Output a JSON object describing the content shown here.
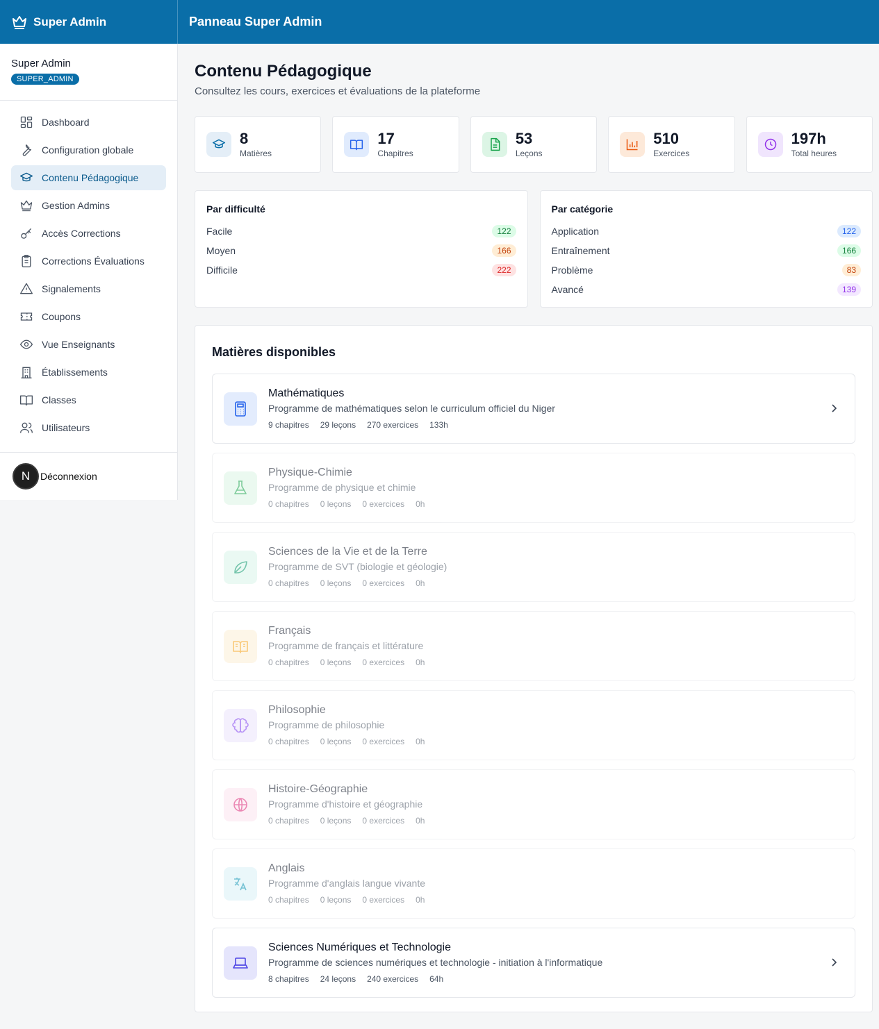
{
  "brand": {
    "title": "Super Admin",
    "icon": "crown-icon"
  },
  "topbar": {
    "title": "Panneau Super Admin"
  },
  "user": {
    "name": "Super Admin",
    "role": "SUPER_ADMIN",
    "avatar_initial": "N"
  },
  "sidebar": {
    "items": [
      {
        "label": "Dashboard",
        "icon": "dashboard-icon",
        "active": false
      },
      {
        "label": "Configuration globale",
        "icon": "wrench-icon",
        "active": false
      },
      {
        "label": "Contenu Pédagogique",
        "icon": "graduation-cap-icon",
        "active": true
      },
      {
        "label": "Gestion Admins",
        "icon": "crown-icon",
        "active": false
      },
      {
        "label": "Accès Corrections",
        "icon": "key-icon",
        "active": false
      },
      {
        "label": "Corrections Évaluations",
        "icon": "clipboard-icon",
        "active": false
      },
      {
        "label": "Signalements",
        "icon": "warning-icon",
        "active": false
      },
      {
        "label": "Coupons",
        "icon": "ticket-icon",
        "active": false
      },
      {
        "label": "Vue Enseignants",
        "icon": "eye-icon",
        "active": false
      },
      {
        "label": "Établissements",
        "icon": "building-icon",
        "active": false
      },
      {
        "label": "Classes",
        "icon": "book-open-icon",
        "active": false
      },
      {
        "label": "Utilisateurs",
        "icon": "users-icon",
        "active": false
      }
    ],
    "logout_label": "Déconnexion"
  },
  "page": {
    "title": "Contenu Pédagogique",
    "subtitle": "Consultez les cours, exercices et évaluations de la plateforme"
  },
  "stats": [
    {
      "value": "8",
      "label": "Matières",
      "icon": "graduation-cap-icon",
      "color": "#0a6ea8",
      "bg": "#e4eef7"
    },
    {
      "value": "17",
      "label": "Chapitres",
      "icon": "book-open-icon",
      "color": "#2563eb",
      "bg": "#e0ebfd"
    },
    {
      "value": "53",
      "label": "Leçons",
      "icon": "file-text-icon",
      "color": "#16a34a",
      "bg": "#dcf5e5"
    },
    {
      "value": "510",
      "label": "Exercices",
      "icon": "bar-chart-icon",
      "color": "#ea580c",
      "bg": "#fde9d9"
    },
    {
      "value": "197h",
      "label": "Total heures",
      "icon": "clock-icon",
      "color": "#9333ea",
      "bg": "#f0e5fd"
    }
  ],
  "by_difficulty": {
    "title": "Par difficulté",
    "rows": [
      {
        "label": "Facile",
        "value": "122",
        "color": "#15803d",
        "bg": "#dcfce7"
      },
      {
        "label": "Moyen",
        "value": "166",
        "color": "#c2410c",
        "bg": "#ffedd5"
      },
      {
        "label": "Difficile",
        "value": "222",
        "color": "#dc2626",
        "bg": "#fee2e2"
      }
    ]
  },
  "by_category": {
    "title": "Par catégorie",
    "rows": [
      {
        "label": "Application",
        "value": "122",
        "color": "#2563eb",
        "bg": "#dbeafe"
      },
      {
        "label": "Entraînement",
        "value": "166",
        "color": "#15803d",
        "bg": "#dcfce7"
      },
      {
        "label": "Problème",
        "value": "83",
        "color": "#c2410c",
        "bg": "#ffedd5"
      },
      {
        "label": "Avancé",
        "value": "139",
        "color": "#9333ea",
        "bg": "#f3e8ff"
      }
    ]
  },
  "subjects": {
    "title": "Matières disponibles",
    "items": [
      {
        "name": "Mathématiques",
        "desc": "Programme de mathématiques selon le curriculum officiel du Niger",
        "chapters": "9 chapitres",
        "lessons": "29 leçons",
        "exercises": "270 exercices",
        "hours": "133h",
        "icon": "calculator-icon",
        "color": "#2563eb",
        "bg": "#e3ecfd",
        "enabled": true
      },
      {
        "name": "Physique-Chimie",
        "desc": "Programme de physique et chimie",
        "chapters": "0 chapitres",
        "lessons": "0 leçons",
        "exercises": "0 exercices",
        "hours": "0h",
        "icon": "flask-icon",
        "color": "#16a34a",
        "bg": "#dcf5e5",
        "enabled": false
      },
      {
        "name": "Sciences de la Vie et de la Terre",
        "desc": "Programme de SVT (biologie et géologie)",
        "chapters": "0 chapitres",
        "lessons": "0 leçons",
        "exercises": "0 exercices",
        "hours": "0h",
        "icon": "leaf-icon",
        "color": "#059669",
        "bg": "#d9f5ea",
        "enabled": false
      },
      {
        "name": "Français",
        "desc": "Programme de français et littérature",
        "chapters": "0 chapitres",
        "lessons": "0 leçons",
        "exercises": "0 exercices",
        "hours": "0h",
        "icon": "book-open-text-icon",
        "color": "#f59e0b",
        "bg": "#fdefd6",
        "enabled": false
      },
      {
        "name": "Philosophie",
        "desc": "Programme de philosophie",
        "chapters": "0 chapitres",
        "lessons": "0 leçons",
        "exercises": "0 exercices",
        "hours": "0h",
        "icon": "brain-icon",
        "color": "#7c3aed",
        "bg": "#ece4fd",
        "enabled": false
      },
      {
        "name": "Histoire-Géographie",
        "desc": "Programme d'histoire et géographie",
        "chapters": "0 chapitres",
        "lessons": "0 leçons",
        "exercises": "0 exercices",
        "hours": "0h",
        "icon": "globe-icon",
        "color": "#db2777",
        "bg": "#fce4ef",
        "enabled": false
      },
      {
        "name": "Anglais",
        "desc": "Programme d'anglais langue vivante",
        "chapters": "0 chapitres",
        "lessons": "0 leçons",
        "exercises": "0 exercices",
        "hours": "0h",
        "icon": "translate-icon",
        "color": "#0891b2",
        "bg": "#d9f2f7",
        "enabled": false
      },
      {
        "name": "Sciences Numériques et Technologie",
        "desc": "Programme de sciences numériques et technologie - initiation à l'informatique",
        "chapters": "8 chapitres",
        "lessons": "24 leçons",
        "exercises": "240 exercices",
        "hours": "64h",
        "icon": "laptop-icon",
        "color": "#4f46e5",
        "bg": "#e5e5fc",
        "enabled": true
      }
    ]
  }
}
